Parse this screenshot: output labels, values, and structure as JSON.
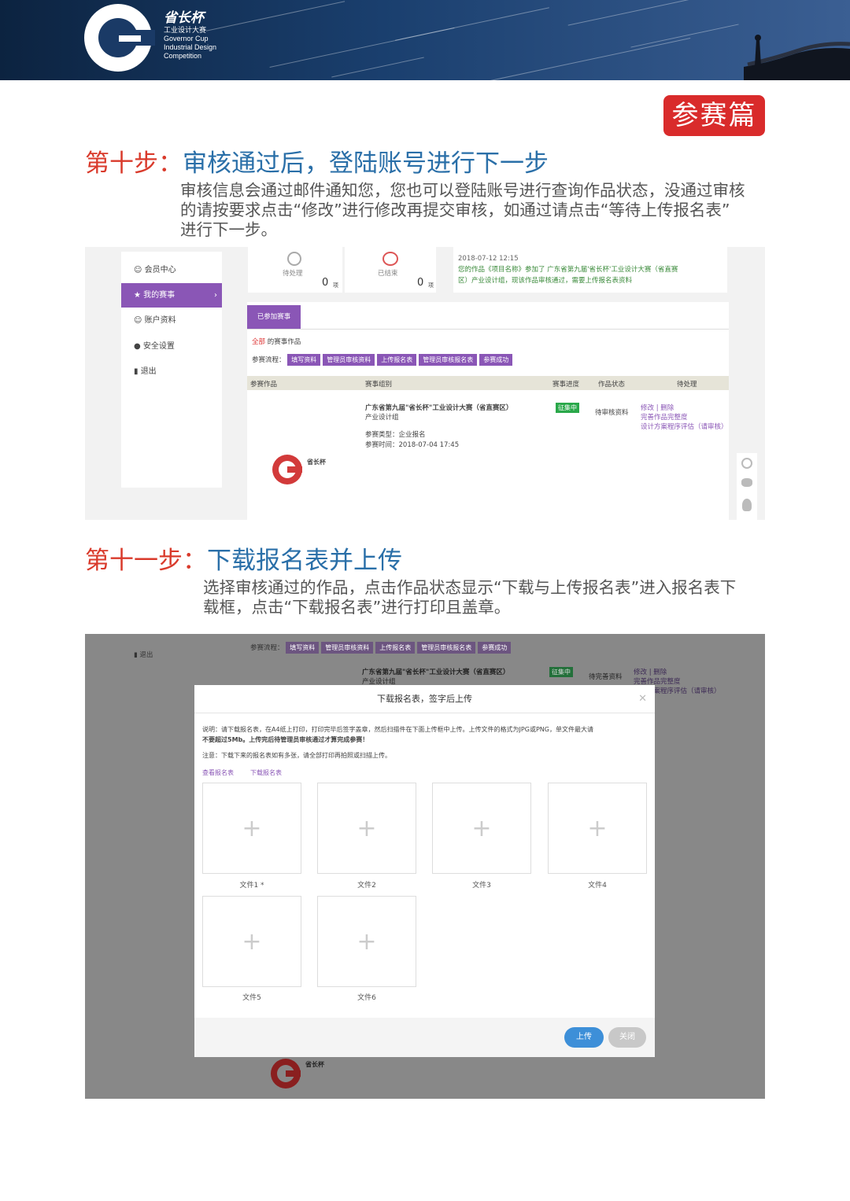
{
  "banner": {
    "logo_cn": "省长杯",
    "logo_line1": "工业设计大赛",
    "logo_line2": "Governor Cup",
    "logo_line3": "Industrial Design",
    "logo_line4": "Competition"
  },
  "badge": "参赛篇",
  "step10": {
    "num": "第十步：",
    "title": "审核通过后，登陆账号进行下一步",
    "desc_line1": "审核信息会通过邮件通知您，您也可以登陆账号进行查询作品状态，没通过审核",
    "desc_line2": "的请按要求点击“修改”进行修改再提交审核，如通过请点击“等待上传报名表”",
    "desc_line3": "进行下一步。"
  },
  "shot1": {
    "sidebar": [
      "会员中心",
      "我的赛事",
      "账户资料",
      "安全设置",
      "退出"
    ],
    "stat1_label": "待处理",
    "stat1_value": "0",
    "stat1_unit": "项",
    "stat2_label": "已结束",
    "stat2_value": "0",
    "stat2_unit": "项",
    "notice_date": "2018-07-12 12:15",
    "notice_text1": "您的作品《项目名称》参加了 广东省第九届'省长杯'工业设计大赛（省直赛",
    "notice_text2": "区）产业设计组，现该作品审核通过，需要上传报名表资料",
    "tab": "已参加赛事",
    "filter_all": "全部",
    "filter_suffix": "的赛事作品",
    "flow_label": "参赛流程：",
    "flow": [
      "填写资料",
      "管理员审核资料",
      "上传报名表",
      "管理员审核报名表",
      "参赛成功"
    ],
    "columns": [
      "参赛作品",
      "赛事组别",
      "赛事进度",
      "作品状态",
      "待处理"
    ],
    "row_title": "广东省第九届\"省长杯\"工业设计大赛（省直赛区）",
    "row_group": "产业设计组",
    "row_type": "参赛类型：企业报名",
    "row_time": "参赛时间：2018-07-04 17:45",
    "row_progress": "征集中",
    "row_status": "待审核资料",
    "row_action1": "修改 | 删除",
    "row_action2": "完善作品完整度",
    "row_action3": "设计方案程序评估（请审核）"
  },
  "step11": {
    "num": "第十一步：",
    "title": "下载报名表并上传",
    "desc_line1": "选择审核通过的作品，点击作品状态显示“下载与上传报名表”进入报名表下",
    "desc_line2": "载框，点击“下载报名表”进行打印且盖章。"
  },
  "shot2": {
    "side_exit": "退出",
    "flow_label": "参赛流程：",
    "flow": [
      "填写资料",
      "管理员审核资料",
      "上传报名表",
      "管理员审核报名表",
      "参赛成功"
    ],
    "row_title": "广东省第九届\"省长杯\"工业设计大赛（省直赛区）",
    "row_group": "产业设计组",
    "row_progress": "征集中",
    "row_status": "待完善资料",
    "row_action1": "修改 | 删除",
    "row_action2": "完善作品完整度",
    "row_action3": "设计方案程序评估（请审核）",
    "modal_title": "下载报名表，签字后上传",
    "modal_note1": "说明：请下载报名表，在A4纸上打印，打印完毕后签字盖章，然后扫描件在下面上传框中上传。上传文件的格式为JPG或PNG，单文件最大请",
    "modal_note2": "不要超过5Mb。上传完后待管理员审核通过才算完成参赛！",
    "modal_note3": "注意：下载下来的报名表如有多张，请全部打印再拍照或扫描上传。",
    "link_view": "查看报名表",
    "link_download": "下载报名表",
    "files": [
      "文件1 *",
      "文件2",
      "文件3",
      "文件4",
      "文件5",
      "文件6"
    ],
    "btn_upload": "上传",
    "btn_close": "关闭"
  }
}
